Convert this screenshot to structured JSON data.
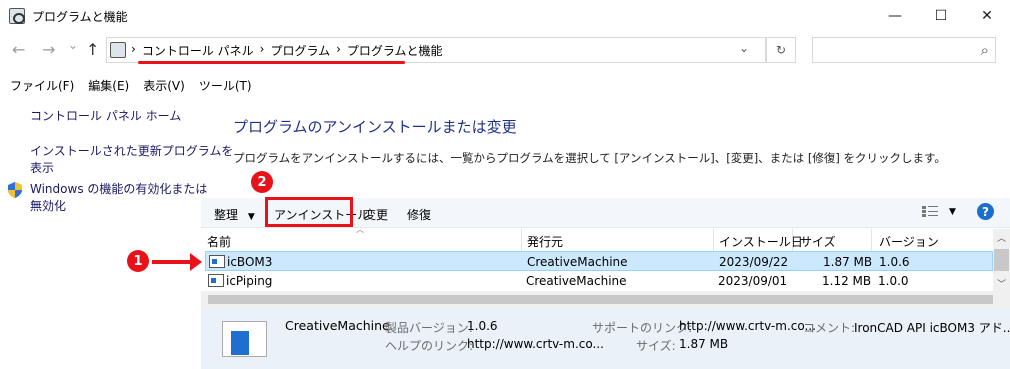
{
  "window": {
    "title": "プログラムと機能",
    "minimize": "—",
    "maximize": "☐",
    "close": "✕"
  },
  "address": {
    "breadcrumbs": [
      "コントロール パネル",
      "プログラム",
      "プログラムと機能"
    ],
    "sep": "›",
    "search_placeholder": ""
  },
  "nav": {
    "back": "←",
    "forward": "→",
    "down": "⌄",
    "up": "↑",
    "dropdown": "⌄",
    "refresh": "↻",
    "search": "⌕"
  },
  "menu": [
    "ファイル(F)",
    "編集(E)",
    "表示(V)",
    "ツール(T)"
  ],
  "left_pane": {
    "home": "コントロール パネル ホーム",
    "updates_line1": "インストールされた更新プログラムを",
    "updates_line2": "表示",
    "features_line1": "Windows の機能の有効化または",
    "features_line2": "無効化"
  },
  "main": {
    "heading": "プログラムのアンインストールまたは変更",
    "description": "プログラムをアンインストールするには、一覧からプログラムを選択して [アンインストール]、[変更]、または [修復] をクリックします。"
  },
  "toolbar": {
    "organize": "整理",
    "organize_caret": "▼",
    "uninstall": "アンインストール",
    "change": "変更",
    "repair": "修復",
    "view_caret": "▼",
    "help": "?"
  },
  "annotations": {
    "badge1": "1",
    "badge2": "2"
  },
  "table": {
    "columns": [
      "名前",
      "発行元",
      "インストール日",
      "サイズ",
      "バージョン"
    ],
    "rows": [
      {
        "name": "icBOM3",
        "publisher": "CreativeMachine",
        "date": "2023/09/22",
        "size": "1.87 MB",
        "version": "1.0.6"
      },
      {
        "name": "icPiping",
        "publisher": "CreativeMachine",
        "date": "2023/09/01",
        "size": "1.12 MB",
        "version": "1.0.0"
      }
    ]
  },
  "details": {
    "publisher": "CreativeMachine",
    "version_label": "製品バージョン:",
    "version": "1.0.6",
    "support_label": "サポートのリンク:",
    "support": "http://www.crtv-m.co...",
    "comment_label": "コメント:",
    "comment": "IronCAD API icBOM3 アド...",
    "help_label": "ヘルプのリンク:",
    "help": "http://www.crtv-m.co...",
    "size_label": "サイズ:",
    "size": "1.87 MB"
  }
}
